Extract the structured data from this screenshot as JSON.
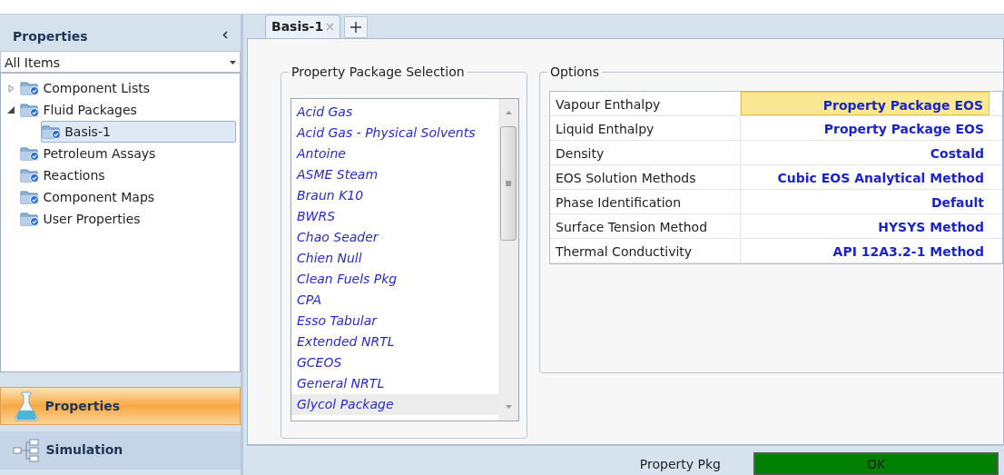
{
  "sidebar": {
    "title": "Properties",
    "filter": {
      "value": "All Items"
    },
    "tree": [
      {
        "label": "Component Lists",
        "expanded": false,
        "selected": false
      },
      {
        "label": "Fluid Packages",
        "expanded": true,
        "selected": false,
        "children": [
          {
            "label": "Basis-1",
            "selected": true
          }
        ]
      },
      {
        "label": "Petroleum Assays",
        "selected": false
      },
      {
        "label": "Reactions",
        "selected": false
      },
      {
        "label": "Component Maps",
        "selected": false
      },
      {
        "label": "User Properties",
        "selected": false
      }
    ],
    "nav": [
      {
        "label": "Properties",
        "kind": "flask",
        "selected": true
      },
      {
        "label": "Simulation",
        "kind": "flowsheet",
        "selected": false
      }
    ]
  },
  "tabs": [
    {
      "label": "Basis-1",
      "selected": true
    }
  ],
  "package_selection": {
    "title": "Property Package Selection",
    "items": [
      {
        "label": "Acid Gas",
        "selected": false
      },
      {
        "label": "Acid Gas - Physical Solvents",
        "selected": false
      },
      {
        "label": "Antoine",
        "selected": false
      },
      {
        "label": "ASME Steam",
        "selected": false
      },
      {
        "label": "Braun K10",
        "selected": false
      },
      {
        "label": "BWRS",
        "selected": false
      },
      {
        "label": "Chao Seader",
        "selected": false
      },
      {
        "label": "Chien Null",
        "selected": false
      },
      {
        "label": "Clean Fuels Pkg",
        "selected": false
      },
      {
        "label": "CPA",
        "selected": false
      },
      {
        "label": "Esso Tabular",
        "selected": false
      },
      {
        "label": "Extended NRTL",
        "selected": false
      },
      {
        "label": "GCEOS",
        "selected": false
      },
      {
        "label": "General NRTL",
        "selected": false
      },
      {
        "label": "Glycol Package",
        "selected": true
      }
    ]
  },
  "options": {
    "title": "Options",
    "rows": [
      {
        "name": "Vapour Enthalpy",
        "value": "Property Package EOS",
        "selected": true
      },
      {
        "name": "Liquid Enthalpy",
        "value": "Property Package EOS",
        "selected": false
      },
      {
        "name": "Density",
        "value": "Costald",
        "selected": false
      },
      {
        "name": "EOS Solution Methods",
        "value": "Cubic EOS Analytical Method",
        "selected": false
      },
      {
        "name": "Phase Identification",
        "value": "Default",
        "selected": false
      },
      {
        "name": "Surface Tension Method",
        "value": "HYSYS Method",
        "selected": false
      },
      {
        "name": "Thermal Conductivity",
        "value": "API 12A3.2-1 Method",
        "selected": false
      }
    ]
  },
  "status_bar": {
    "label": "Property Pkg",
    "status": "OK",
    "color": "#008000"
  }
}
